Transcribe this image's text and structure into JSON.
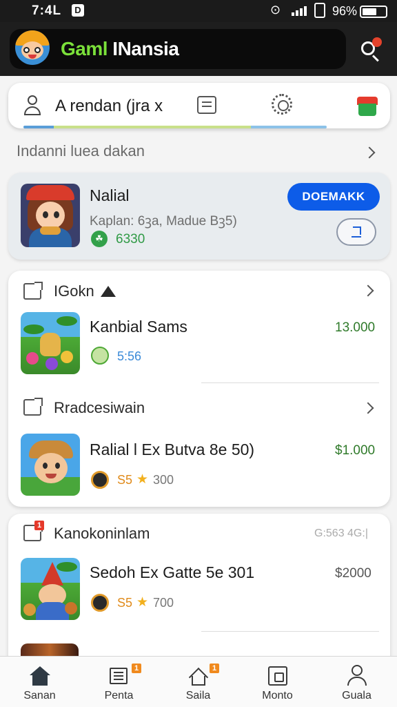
{
  "status_bar": {
    "time": "7:4L",
    "notification_glyph": "D",
    "battery_percent": "96%"
  },
  "app": {
    "title_prefix": "Gaml",
    "title_suffix": " INansia"
  },
  "topbar": {
    "username": "A rendan (jra x"
  },
  "section": {
    "title": "Indanni luea dakan"
  },
  "featured": {
    "title": "Nalial",
    "subtitle": "Kaplan: 6ꝫa, Madue Bꝫ5)",
    "price": "6330",
    "cta_label": "DOEMAKK"
  },
  "categories": [
    {
      "title": "IGokn",
      "items": [
        {
          "title": "Kanbial Sams",
          "price": "13.000",
          "stat": "5:56"
        }
      ]
    },
    {
      "title": "Rradcesiwain",
      "items": [
        {
          "title": "Ralial l Ex Butva 8e 50)",
          "price": "$1.000",
          "stat": "S5",
          "rating": "300"
        }
      ]
    },
    {
      "title": "Kanokoninlam",
      "right_label": "G:563 4G:|",
      "items": [
        {
          "title": "Sedoh Ex Gatte 5e 301",
          "price": "$2000",
          "stat": "S5",
          "rating": "700"
        }
      ]
    }
  ],
  "bottom_nav": [
    {
      "label": "Sanan",
      "icon": "home-icon"
    },
    {
      "label": "Penta",
      "icon": "list-icon",
      "badge": "1"
    },
    {
      "label": "Saila",
      "icon": "house-icon",
      "badge": "1"
    },
    {
      "label": "Monto",
      "icon": "frame-icon"
    },
    {
      "label": "Guala",
      "icon": "person-icon"
    }
  ],
  "colors": {
    "accent_blue": "#0d5ce8",
    "price_green": "#2f9a45",
    "header_bg": "#1e1e1e",
    "star_gold": "#f2b01e"
  }
}
